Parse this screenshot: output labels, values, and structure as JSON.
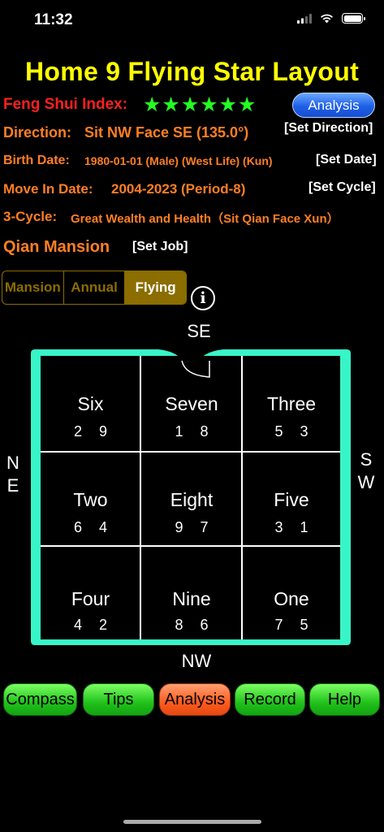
{
  "status_bar": {
    "time": "11:32"
  },
  "title": "Home 9 Flying Star Layout",
  "index": {
    "label": "Feng Shui Index:",
    "stars": "★★★★★★",
    "analysis_button": "Analysis"
  },
  "direction": {
    "label": "Direction:",
    "value": "Sit NW Face SE (135.0°)",
    "action": "[Set Direction]"
  },
  "birth": {
    "label": "Birth Date:",
    "value": "1980-01-01 (Male) (West Life) (Kun)",
    "action": "[Set Date]"
  },
  "move_in": {
    "label": "Move In Date:",
    "value": "2004-2023 (Period-8)",
    "action": "[Set Cycle]"
  },
  "cycle": {
    "label": "3-Cycle:",
    "value": "Great Wealth and Health（Sit Qian Face Xun）"
  },
  "mansion": {
    "label": "Qian Mansion",
    "action": "[Set Job]"
  },
  "segments": [
    "Mansion",
    "Annual",
    "Flying"
  ],
  "active_segment": "Flying",
  "info_icon": "i",
  "compass": {
    "top": "SE",
    "bottom": "NW",
    "left_1": "N",
    "left_2": "E",
    "right_1": "S",
    "right_2": "W"
  },
  "grid": [
    {
      "name": "Six",
      "nums": "2 9"
    },
    {
      "name": "Seven",
      "nums": "1 8"
    },
    {
      "name": "Three",
      "nums": "5 3"
    },
    {
      "name": "Two",
      "nums": "6 4"
    },
    {
      "name": "Eight",
      "nums": "9 7"
    },
    {
      "name": "Five",
      "nums": "3 1"
    },
    {
      "name": "Four",
      "nums": "4 2"
    },
    {
      "name": "Nine",
      "nums": "8 6"
    },
    {
      "name": "One",
      "nums": "7 5"
    }
  ],
  "bottom_buttons": [
    "Compass",
    "Tips",
    "Analysis",
    "Record",
    "Help"
  ],
  "colors": {
    "title": "#ffff00",
    "label": "#ff7f24",
    "index_label": "#ff2020",
    "stars": "#22ff22",
    "frame": "#38f5c8",
    "segment": "#8b6d00",
    "button_green": "#21c21b",
    "button_orange": "#ff5b1f"
  }
}
